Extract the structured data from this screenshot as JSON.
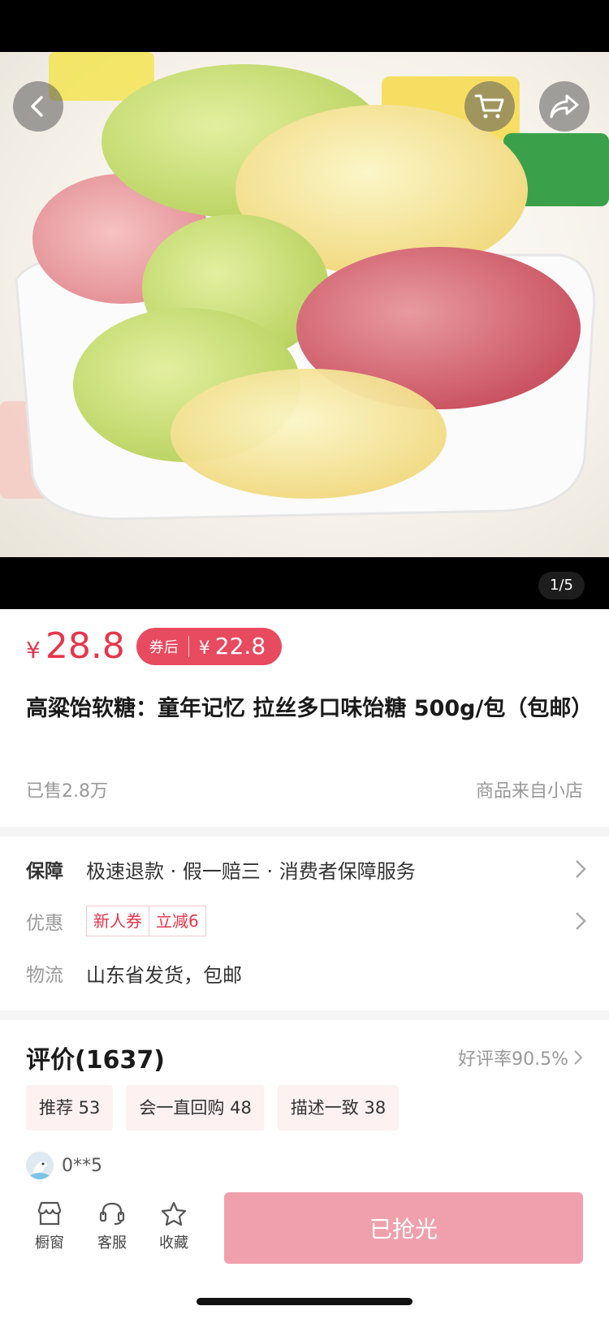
{
  "gallery": {
    "page_indicator": "1/5"
  },
  "price": {
    "currency": "¥",
    "value": "28.8",
    "coupon_label": "券后",
    "coupon_currency": "¥",
    "coupon_value": "22.8"
  },
  "product": {
    "title": "高粱饴软糖：童年记忆 拉丝多口味饴糖 500g/包（包邮）",
    "sold": "已售2.8万",
    "store": "商品来自小店"
  },
  "info": {
    "guarantee_key": "保障",
    "guarantee_val": "极速退款 · 假一赔三 · 消费者保障服务",
    "promo_key": "优惠",
    "promo_tags": [
      "新人券",
      "立减6"
    ],
    "shipping_key": "物流",
    "shipping_val": "山东省发货，包邮"
  },
  "reviews": {
    "title": "评价(1637)",
    "rating": "好评率90.5%",
    "chips": [
      "推荐 53",
      "会一直回购 48",
      "描述一致 38"
    ],
    "reviewer": "0**5"
  },
  "bottom_bar": {
    "showcase": "橱窗",
    "service": "客服",
    "favorite": "收藏",
    "buy": "已抢光"
  },
  "colors": {
    "accent": "#e8344a",
    "coupon_bg": "#e84a5f",
    "buy_disabled": "#f0a0ac",
    "chip_bg": "#fdf1f2"
  },
  "icons": [
    "back-icon",
    "cart-icon",
    "share-icon",
    "chevron-right-icon",
    "store-icon",
    "headset-icon",
    "star-icon"
  ]
}
